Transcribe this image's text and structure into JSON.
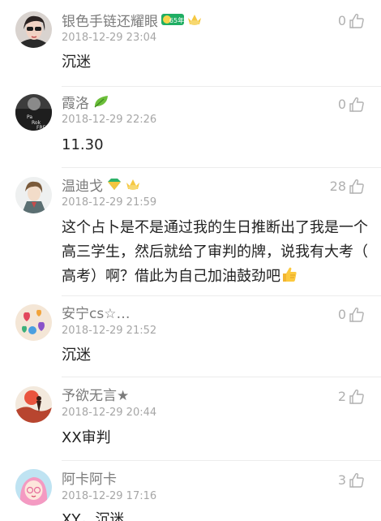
{
  "comments": [
    {
      "username": "银色手链还耀眼",
      "badges": [
        "level-badge-icon",
        "crown-badge-icon"
      ],
      "level_badge_text": "65年",
      "timestamp": "2018-12-29 23:04",
      "likes": "0",
      "content": "沉迷",
      "avatar": "avatar-woman-sunglasses"
    },
    {
      "username": "霞洛",
      "badges": [
        "leaf-badge-icon"
      ],
      "timestamp": "2018-12-29 22:26",
      "likes": "0",
      "content": "11.30",
      "avatar": "avatar-dark-jacket"
    },
    {
      "username": "温迪戈",
      "badges": [
        "gem-badge-icon",
        "crown-badge-icon"
      ],
      "timestamp": "2018-12-29 21:59",
      "likes": "28",
      "content": "这个占卜是不是通过我的生日推断出了我是高三学生，然后就给了审判的牌，说我有大考（高考）啊？借此为自己加油鼓劲吧",
      "content_lines": [
        "这个占卜是不是通过我的生日推断出了我是一个",
        "高三学生，然后就给了审判的牌，说我有大考（",
        "高考）啊？借此为自己加油鼓劲吧"
      ],
      "content_emoji": "thumbs-up-emoji",
      "avatar": "avatar-anime-man"
    },
    {
      "username": "安宁cs☆…",
      "badges": [],
      "timestamp": "2018-12-29 21:52",
      "likes": "0",
      "content": "沉迷",
      "avatar": "avatar-colorful-hearts"
    },
    {
      "username": "予欲无言★",
      "badges": [],
      "timestamp": "2018-12-29 20:44",
      "likes": "2",
      "content": "XX审判",
      "avatar": "avatar-red-sunset"
    },
    {
      "username": "阿卡阿卡",
      "badges": [],
      "timestamp": "2018-12-29 17:16",
      "likes": "3",
      "content": "XY，沉迷",
      "avatar": "avatar-pink-girl"
    }
  ],
  "colors": {
    "username": "#7b7b7b",
    "timestamp": "#a6a6a6",
    "content": "#222222",
    "like": "#b0b0b0",
    "divider": "#ececec"
  }
}
